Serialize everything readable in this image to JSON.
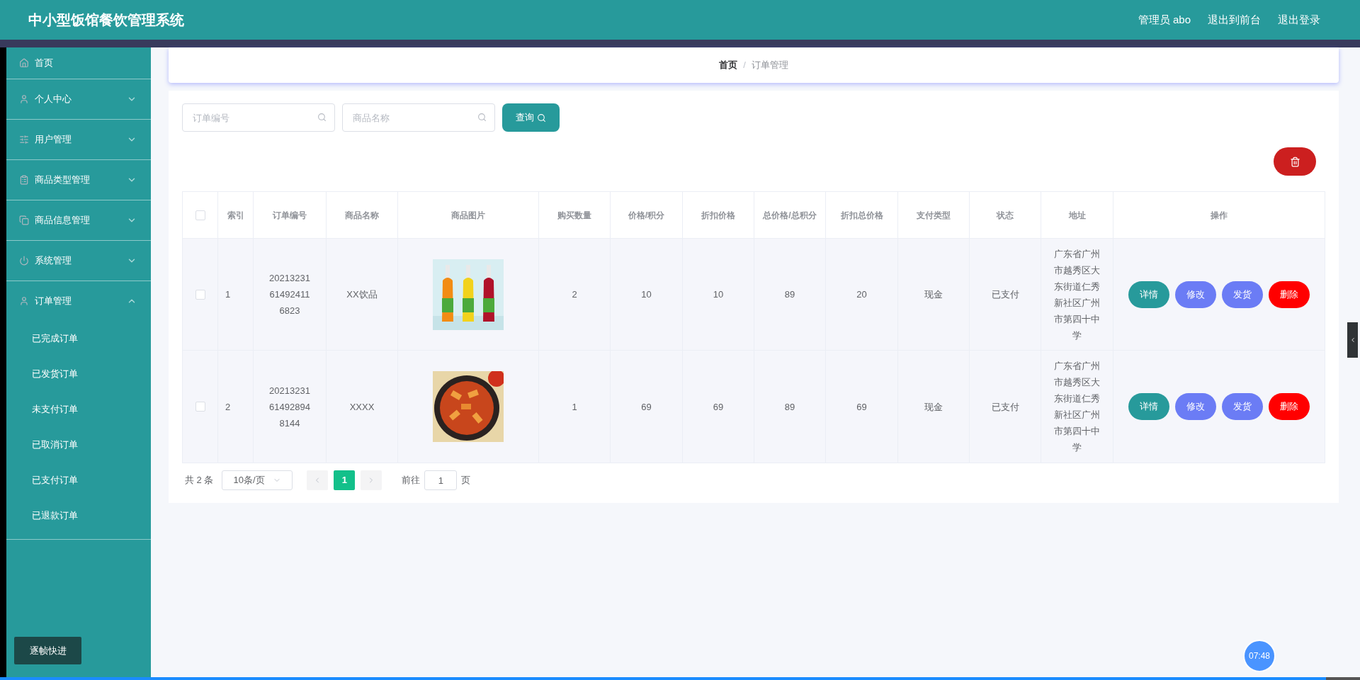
{
  "header": {
    "title": "中小型饭馆餐饮管理系统",
    "links": [
      "管理员 abo",
      "退出到前台",
      "退出登录"
    ]
  },
  "sidebar": {
    "items": [
      {
        "label": "首页",
        "kind": "link"
      },
      {
        "label": "个人中心",
        "kind": "menu",
        "expanded": false
      },
      {
        "label": "用户管理",
        "kind": "menu",
        "expanded": false
      },
      {
        "label": "商品类型管理",
        "kind": "menu",
        "expanded": false
      },
      {
        "label": "商品信息管理",
        "kind": "menu",
        "expanded": false
      },
      {
        "label": "系统管理",
        "kind": "menu",
        "expanded": false
      },
      {
        "label": "订单管理",
        "kind": "menu",
        "expanded": true,
        "children": [
          {
            "label": "已完成订单"
          },
          {
            "label": "已发货订单"
          },
          {
            "label": "未支付订单"
          },
          {
            "label": "已取消订单"
          },
          {
            "label": "已支付订单"
          },
          {
            "label": "已退款订单"
          }
        ]
      }
    ]
  },
  "breadcrumb": {
    "items": [
      "首页",
      "订单管理"
    ],
    "separator": "/"
  },
  "search": {
    "fields": [
      {
        "placeholder": "订单编号"
      },
      {
        "placeholder": "商品名称"
      }
    ],
    "button": "查询"
  },
  "table": {
    "columns": [
      "索引",
      "订单编号",
      "商品名称",
      "商品图片",
      "购买数量",
      "价格/积分",
      "折扣价格",
      "总价格/总积分",
      "折扣总价格",
      "支付类型",
      "状态",
      "地址",
      "操作"
    ],
    "rows": [
      {
        "checked": false,
        "index": "1",
        "order_no": "20213231614924116823",
        "product": "XX饮品",
        "quantity": "2",
        "price": "10",
        "discount_price": "10",
        "total": "89",
        "discount_total": "20",
        "payment": "现金",
        "status": "已支付",
        "address": "广东省广州市越秀区大东街道仁秀新社区广州市第四十中学",
        "actions": [
          {
            "label": "详情",
            "kind": "detail"
          },
          {
            "label": "修改",
            "kind": "edit"
          },
          {
            "label": "发货",
            "kind": "ship"
          },
          {
            "label": "删除",
            "kind": "delete"
          }
        ]
      },
      {
        "checked": false,
        "index": "2",
        "order_no": "20213231614928948144",
        "product": "XXXX",
        "quantity": "1",
        "price": "69",
        "discount_price": "69",
        "total": "89",
        "discount_total": "69",
        "payment": "现金",
        "status": "已支付",
        "address": "广东省广州市越秀区大东街道仁秀新社区广州市第四十中学",
        "actions": [
          {
            "label": "详情",
            "kind": "detail"
          },
          {
            "label": "修改",
            "kind": "edit"
          },
          {
            "label": "发货",
            "kind": "ship"
          },
          {
            "label": "删除",
            "kind": "delete"
          }
        ]
      }
    ],
    "all_checked": false
  },
  "pagination": {
    "total": "共 2 条",
    "page_size": "10条/页",
    "pages": [
      {
        "label": "1",
        "selected": true
      }
    ],
    "goto_label": "前往",
    "goto_value": "1",
    "page_unit": "页"
  },
  "overlay": {
    "frame_button": "逐帧快进",
    "timer": "07:48",
    "progress": {
      "level": 0.975
    }
  }
}
